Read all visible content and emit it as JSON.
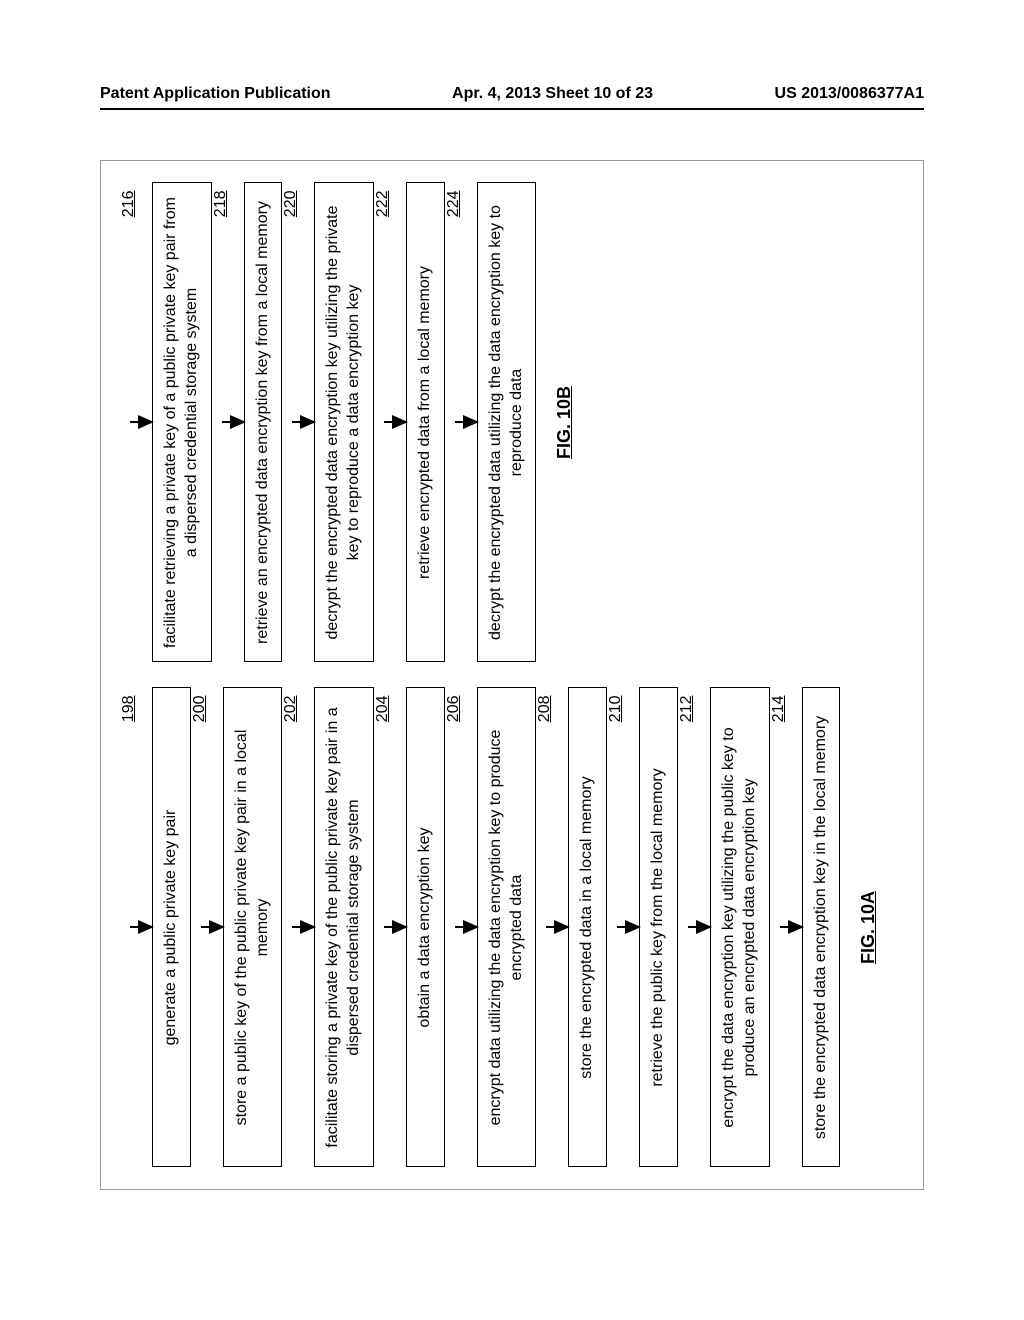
{
  "header": {
    "left": "Patent Application Publication",
    "center": "Apr. 4, 2013  Sheet 10 of 23",
    "right": "US 2013/0086377A1"
  },
  "figA": {
    "label": "FIG. 10A",
    "steps": [
      {
        "ref": "198",
        "text": "generate a public private key pair"
      },
      {
        "ref": "200",
        "text": "store a public key of the public private key pair in a local memory"
      },
      {
        "ref": "202",
        "text": "facilitate storing a private key of the public private key pair in a dispersed credential storage system"
      },
      {
        "ref": "204",
        "text": "obtain a data encryption key"
      },
      {
        "ref": "206",
        "text": "encrypt data utilizing the data encryption key to produce encrypted data"
      },
      {
        "ref": "208",
        "text": "store the encrypted data in a local memory"
      },
      {
        "ref": "210",
        "text": "retrieve the public key from the local memory"
      },
      {
        "ref": "212",
        "text": "encrypt the data encryption key utilizing the public key to produce an encrypted data encryption key"
      },
      {
        "ref": "214",
        "text": "store the encrypted data encryption key in the local memory"
      }
    ]
  },
  "figB": {
    "label": "FIG. 10B",
    "steps": [
      {
        "ref": "216",
        "text": "facilitate retrieving a private key of a public private key pair from a dispersed credential storage system"
      },
      {
        "ref": "218",
        "text": "retrieve an encrypted data encryption key from a local memory"
      },
      {
        "ref": "220",
        "text": "decrypt the encrypted data encryption key utilizing the private key to reproduce a data encryption key"
      },
      {
        "ref": "222",
        "text": "retrieve encrypted data from a local memory"
      },
      {
        "ref": "224",
        "text": "decrypt the encrypted data utilizing the data encryption key to reproduce data"
      }
    ]
  }
}
